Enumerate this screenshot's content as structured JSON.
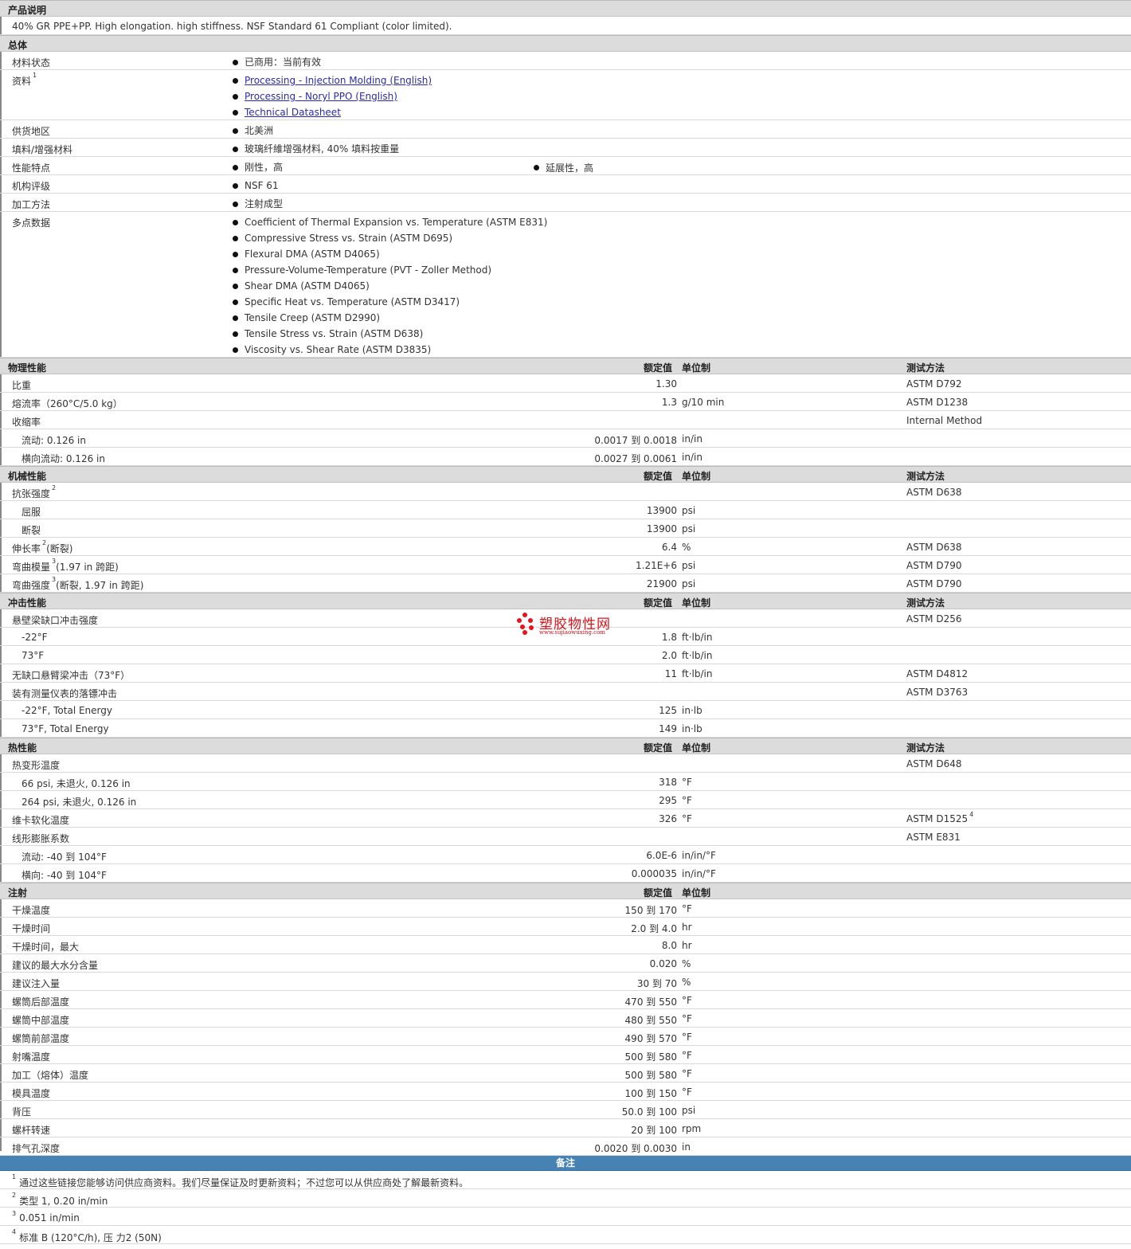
{
  "product_desc": {
    "title": "产品说明",
    "text": "40% GR PPE+PP. High elongation. high stiffness. NSF Standard 61 Compliant (color limited)."
  },
  "general": {
    "title": "总体",
    "status_label": "材料状态",
    "status_value": "已商用：当前有效",
    "docs_label": "资料",
    "docs_sup": "1",
    "docs": [
      "Processing - Injection Molding (English)",
      "Processing - Noryl PPO (English)",
      "Technical Datasheet"
    ],
    "region_label": "供货地区",
    "region_value": "北美洲",
    "filler_label": "填料/增强材料",
    "filler_value": "玻璃纤維增强材料, 40% 填料按重量",
    "features_label": "性能特点",
    "features": [
      "刚性，高",
      "延展性，高"
    ],
    "agency_label": "机构评级",
    "agency_value": "NSF 61",
    "process_label": "加工方法",
    "process_value": "注射成型",
    "multipoint_label": "多点数据",
    "multipoint": [
      "Coefficient of Thermal Expansion vs. Temperature (ASTM E831)",
      "Compressive Stress vs. Strain (ASTM D695)",
      "Flexural DMA (ASTM D4065)",
      "Pressure-Volume-Temperature (PVT - Zoller Method)",
      "Shear DMA (ASTM D4065)",
      "Specific Heat vs. Temperature (ASTM D3417)",
      "Tensile Creep (ASTM D2990)",
      "Tensile Stress vs. Strain (ASTM D638)",
      "Viscosity vs. Shear Rate (ASTM D3835)"
    ]
  },
  "headers": {
    "value": "额定值",
    "unit": "单位制",
    "method": "测试方法"
  },
  "physical": {
    "title": "物理性能",
    "rows": [
      {
        "label": "比重",
        "value": "1.30",
        "unit": "",
        "method": "ASTM D792"
      },
      {
        "label": "熔流率（260°C/5.0 kg）",
        "value": "1.3",
        "unit": "g/10 min",
        "method": "ASTM D1238"
      },
      {
        "label": "收缩率",
        "value": "",
        "unit": "",
        "method": "Internal Method"
      },
      {
        "label": "流动: 0.126 in",
        "value": "0.0017 到  0.0018",
        "unit": "in/in",
        "method": ""
      },
      {
        "label": "横向流动: 0.126 in",
        "value": "0.0027 到  0.0061",
        "unit": "in/in",
        "method": ""
      }
    ]
  },
  "mechanical": {
    "title": "机械性能",
    "rows": [
      {
        "label": "抗张强度",
        "sup": "2",
        "value": "",
        "unit": "",
        "method": "ASTM D638"
      },
      {
        "label": "屈服",
        "value": "13900",
        "unit": "psi",
        "method": ""
      },
      {
        "label": "断裂",
        "value": "13900",
        "unit": "psi",
        "method": ""
      },
      {
        "label": "伸长率",
        "sup": "2",
        "suffix": "(断裂)",
        "value": "6.4",
        "unit": "%",
        "method": "ASTM D638"
      },
      {
        "label": "弯曲模量",
        "sup": "3",
        "suffix": "(1.97 in 跨距)",
        "value": "1.21E+6",
        "unit": "psi",
        "method": "ASTM D790"
      },
      {
        "label": "弯曲强度",
        "sup": "3",
        "suffix": "(断裂, 1.97 in 跨距)",
        "value": "21900",
        "unit": "psi",
        "method": "ASTM D790"
      }
    ]
  },
  "impact": {
    "title": "冲击性能",
    "rows": [
      {
        "label": "悬壁梁缺口冲击强度",
        "value": "",
        "unit": "",
        "method": "ASTM D256"
      },
      {
        "label": "-22°F",
        "value": "1.8",
        "unit": "ft·lb/in",
        "method": ""
      },
      {
        "label": "73°F",
        "value": "2.0",
        "unit": "ft·lb/in",
        "method": ""
      },
      {
        "label": "无缺口悬臂梁冲击（73°F）",
        "value": "11",
        "unit": "ft·lb/in",
        "method": "ASTM D4812"
      },
      {
        "label": "装有测量仪表的落镖冲击",
        "value": "",
        "unit": "",
        "method": "ASTM D3763"
      },
      {
        "label": "-22°F, Total Energy",
        "value": "125",
        "unit": "in·lb",
        "method": ""
      },
      {
        "label": "73°F, Total Energy",
        "value": "149",
        "unit": "in·lb",
        "method": ""
      }
    ]
  },
  "thermal": {
    "title": "热性能",
    "rows": [
      {
        "label": "热变形温度",
        "value": "",
        "unit": "",
        "method": "ASTM D648"
      },
      {
        "label": "66 psi, 未退火, 0.126 in",
        "value": "318",
        "unit": "°F",
        "method": ""
      },
      {
        "label": "264 psi, 未退火, 0.126 in",
        "value": "295",
        "unit": "°F",
        "method": ""
      },
      {
        "label": "维卡软化温度",
        "value": "326",
        "unit": "°F",
        "method": "ASTM D1525",
        "method_sup": "4"
      },
      {
        "label": "线形膨胀系数",
        "value": "",
        "unit": "",
        "method": "ASTM E831"
      },
      {
        "label": "流动: -40 到  104°F",
        "value": "6.0E-6",
        "unit": "in/in/°F",
        "method": ""
      },
      {
        "label": "横向: -40 到  104°F",
        "value": "0.000035",
        "unit": "in/in/°F",
        "method": ""
      }
    ]
  },
  "injection": {
    "title": "注射",
    "rows": [
      {
        "label": "干燥温度",
        "value": "150 到  170",
        "unit": "°F"
      },
      {
        "label": "干燥时间",
        "value": "2.0 到  4.0",
        "unit": "hr"
      },
      {
        "label": "干燥时间，最大",
        "value": "8.0",
        "unit": "hr"
      },
      {
        "label": "建议的最大水分含量",
        "value": "0.020",
        "unit": "%"
      },
      {
        "label": "建议注入量",
        "value": "30 到  70",
        "unit": "%"
      },
      {
        "label": "螺筒后部温度",
        "value": "470 到  550",
        "unit": "°F"
      },
      {
        "label": "螺筒中部温度",
        "value": "480 到  550",
        "unit": "°F"
      },
      {
        "label": "螺筒前部温度",
        "value": "490 到  570",
        "unit": "°F"
      },
      {
        "label": "射嘴温度",
        "value": "500 到  580",
        "unit": "°F"
      },
      {
        "label": "加工（熔体）温度",
        "value": "500 到  580",
        "unit": "°F"
      },
      {
        "label": "模具温度",
        "value": "100 到  150",
        "unit": "°F"
      },
      {
        "label": "背压",
        "value": "50.0 到  100",
        "unit": "psi"
      },
      {
        "label": "螺杆转速",
        "value": "20 到  100",
        "unit": "rpm"
      },
      {
        "label": "排气孔深度",
        "value": "0.0020 到  0.0030",
        "unit": "in"
      }
    ]
  },
  "notes": {
    "title": "备注",
    "items": [
      {
        "num": "1",
        "text": "通过这些链接您能够访问供应商资料。我们尽量保证及时更新资料；不过您可以从供应商处了解最新资料。"
      },
      {
        "num": "2",
        "text": "类型  1, 0.20 in/min"
      },
      {
        "num": "3",
        "text": "0.051 in/min"
      },
      {
        "num": "4",
        "text": "标准  B (120°C/h), 压  力2 (50N)"
      }
    ]
  },
  "watermark": {
    "cn": "塑胶物性网",
    "en": "www.sujiaowuxing.com",
    "color": "#e8141b"
  }
}
